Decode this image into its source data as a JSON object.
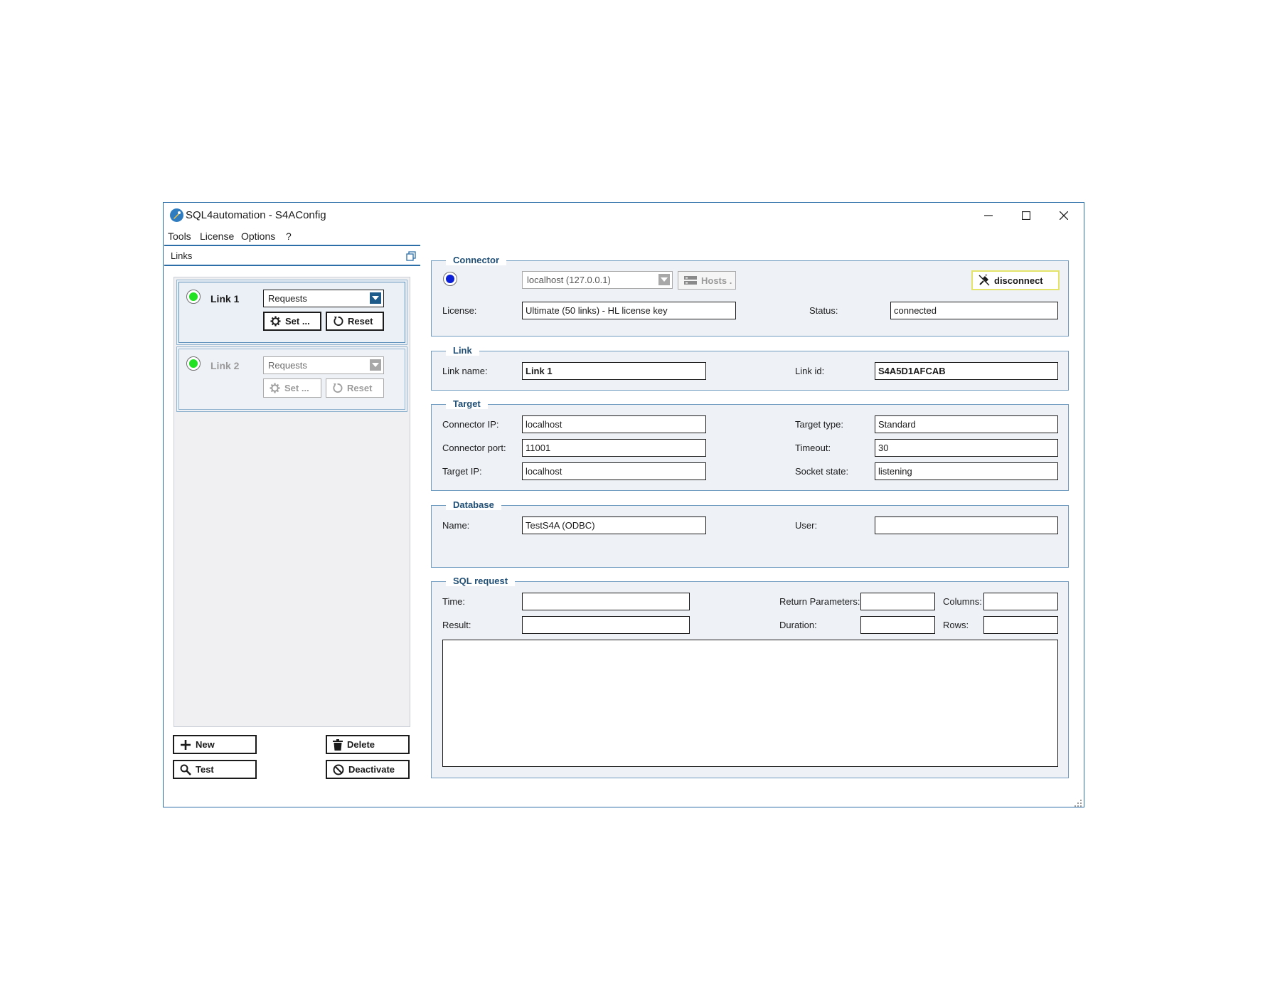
{
  "window": {
    "title": "SQL4automation - S4AConfig",
    "minimize_icon": "minimize-icon",
    "maximize_icon": "maximize-icon",
    "close_icon": "close-icon"
  },
  "menu": {
    "items": [
      "Tools",
      "License",
      "Options",
      "?"
    ]
  },
  "links_panel": {
    "header": "Links",
    "cards": [
      {
        "name": "Link 1",
        "mode": "Requests",
        "set_label": "Set ...",
        "reset_label": "Reset",
        "active": true
      },
      {
        "name": "Link 2",
        "mode": "Requests",
        "set_label": "Set ...",
        "reset_label": "Reset",
        "active": false
      }
    ],
    "buttons": {
      "new": "New",
      "delete": "Delete",
      "test": "Test",
      "deactivate": "Deactivate"
    }
  },
  "connector": {
    "title": "Connector",
    "host": "localhost (127.0.0.1)",
    "hosts_button": "Hosts .",
    "disconnect_button": "disconnect",
    "license_label": "License:",
    "license_value": "Ultimate (50 links) - HL license key",
    "status_label": "Status:",
    "status_value": "connected"
  },
  "link": {
    "title": "Link",
    "name_label": "Link name:",
    "name_value": "Link 1",
    "id_label": "Link id:",
    "id_value": "S4A5D1AFCAB"
  },
  "target": {
    "title": "Target",
    "connector_ip_label": "Connector IP:",
    "connector_ip_value": "localhost",
    "connector_port_label": "Connector port:",
    "connector_port_value": "11001",
    "target_ip_label": "Target IP:",
    "target_ip_value": "localhost",
    "target_type_label": "Target type:",
    "target_type_value": "Standard",
    "timeout_label": "Timeout:",
    "timeout_value": "30",
    "socket_state_label": "Socket state:",
    "socket_state_value": "listening"
  },
  "database": {
    "title": "Database",
    "name_label": "Name:",
    "name_value": "TestS4A (ODBC)",
    "user_label": "User:",
    "user_value": ""
  },
  "sql_request": {
    "title": "SQL request",
    "time_label": "Time:",
    "result_label": "Result:",
    "return_params_label": "Return Parameters:",
    "duration_label": "Duration:",
    "columns_label": "Columns:",
    "rows_label": "Rows:"
  },
  "colors": {
    "accent": "#2b6ea8",
    "group_bg": "#eef2f7",
    "led_green": "#22e022",
    "led_blue": "#0a1fd6"
  }
}
